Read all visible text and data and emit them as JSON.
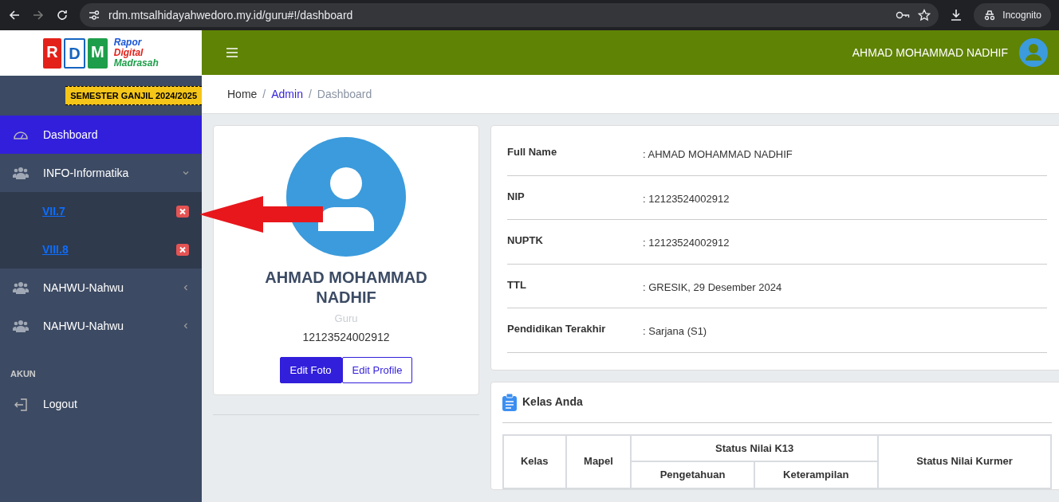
{
  "browser": {
    "url": "rdm.mtsalhidayahwedoro.my.id/guru#!/dashboard",
    "profile_label": "Incognito"
  },
  "logo": {
    "letters": [
      "R",
      "D",
      "M"
    ],
    "lines": [
      "Rapor",
      "Digital",
      "Madrasah"
    ]
  },
  "semester_badge": "SEMESTER GANJIL 2024/2025",
  "sidebar": {
    "items": [
      {
        "kind": "dashboard",
        "label": "Dashboard",
        "selected": true
      },
      {
        "kind": "group",
        "label": "INFO-Informatika",
        "expanded": true,
        "children": [
          {
            "label": "VII.7",
            "removable": true
          },
          {
            "label": "VIII.8",
            "removable": true
          }
        ]
      },
      {
        "kind": "group",
        "label": "NAHWU-Nahwu",
        "expanded": false
      },
      {
        "kind": "group",
        "label": "NAHWU-Nahwu",
        "expanded": false
      },
      {
        "kind": "header",
        "label": "AKUN"
      },
      {
        "kind": "logout",
        "label": "Logout",
        "selected": false
      }
    ]
  },
  "header": {
    "user_name": "AHMAD MOHAMMAD NADHIF"
  },
  "breadcrumb_separator": "/",
  "breadcrumb": [
    {
      "label": "Home",
      "kind": "plain"
    },
    {
      "label": "Admin",
      "kind": "link"
    },
    {
      "label": "Dashboard",
      "kind": "current"
    }
  ],
  "profile": {
    "name": "AHMAD MOHAMMAD NADHIF",
    "role": "Guru",
    "id_number": "12123524002912",
    "buttons": [
      {
        "label": "Edit Foto",
        "kind": "primary"
      },
      {
        "label": "Edit Profile",
        "kind": "outline"
      }
    ]
  },
  "details": [
    {
      "label": "Full Name",
      "value": ": AHMAD MOHAMMAD NADHIF"
    },
    {
      "label": "NIP",
      "value": ": 12123524002912"
    },
    {
      "label": "NUPTK",
      "value": ": 12123524002912"
    },
    {
      "label": "TTL",
      "value": ": GRESIK, 29 Desember 2024"
    },
    {
      "label": "Pendidikan Terakhir",
      "value": ": Sarjana (S1)"
    }
  ],
  "classes": {
    "title": "Kelas Anda",
    "columns": [
      "Kelas",
      "Mapel",
      "Status Nilai K13",
      "Status Nilai Kurmer"
    ],
    "subcolumns": [
      "Pengetahuan",
      "Keterampilan"
    ]
  }
}
